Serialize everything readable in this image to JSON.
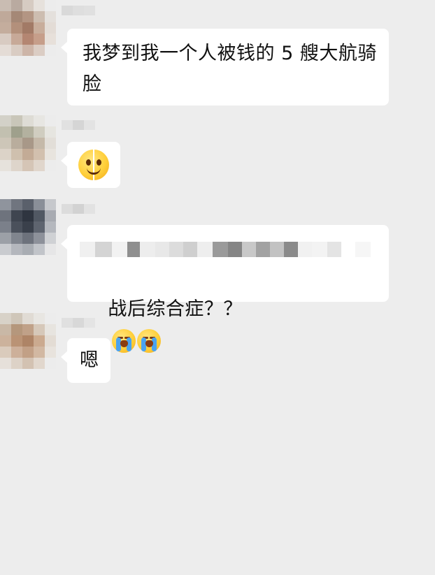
{
  "chat": {
    "messages": [
      {
        "sender": "",
        "text": "我梦到我一个人被钱的 5 艘大航骑\n脸"
      },
      {
        "sender": "",
        "emoji": "cracked-smiling-face-emoji"
      },
      {
        "sender": "",
        "text": "战后综合症？？",
        "emojis": [
          "loudly-crying-face-emoji",
          "loudly-crying-face-emoji"
        ]
      },
      {
        "sender": "",
        "text": "嗯"
      }
    ]
  },
  "colors": {
    "background": "#ededed",
    "bubble": "#ffffff",
    "text": "#111111"
  }
}
